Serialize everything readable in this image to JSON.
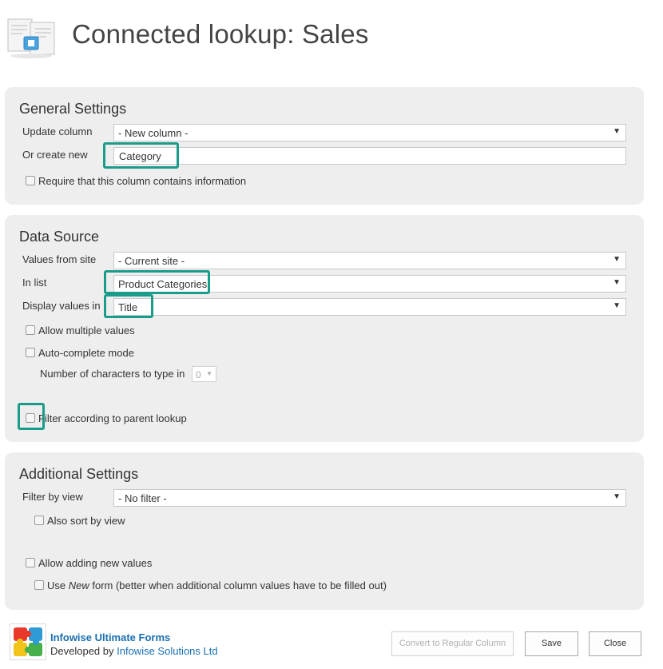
{
  "header": {
    "title": "Connected lookup: Sales",
    "icon": "document-lookup-icon"
  },
  "general": {
    "title": "General Settings",
    "update_column_label": "Update column",
    "update_column_value": "- New column -",
    "or_create_label": "Or create new",
    "or_create_value": "Category",
    "require_label": "Require that this column contains information",
    "require_checked": false
  },
  "data_source": {
    "title": "Data Source",
    "values_from_site_label": "Values from site",
    "values_from_site_value": "- Current site -",
    "in_list_label": "In list",
    "in_list_value": "Product Categories",
    "display_values_label": "Display values in",
    "display_values_value": "Title",
    "allow_multiple_label": "Allow multiple values",
    "allow_multiple_checked": false,
    "auto_complete_label": "Auto-complete mode",
    "auto_complete_checked": false,
    "num_chars_label": "Number of characters to type in",
    "num_chars_value": "0",
    "filter_parent_label": "Filter according to parent lookup",
    "filter_parent_checked": false
  },
  "additional": {
    "title": "Additional Settings",
    "filter_by_view_label": "Filter by view",
    "filter_by_view_value": "- No filter -",
    "also_sort_label": "Also sort by view",
    "allow_adding_label": "Allow adding new values",
    "use_new_form_prefix": "Use ",
    "use_new_form_em": "New",
    "use_new_form_suffix": " form (better when additional column values have to be filled out)"
  },
  "footer": {
    "brand": "Infowise Ultimate Forms",
    "developed_by": "Developed by ",
    "company": "Infowise Solutions Ltd",
    "convert_button": "Convert to Regular Column",
    "save_button": "Save",
    "close_button": "Close"
  },
  "colors": {
    "highlight": "#1a9c8b",
    "panel": "#eeeeee",
    "link": "#1a6fb0"
  }
}
